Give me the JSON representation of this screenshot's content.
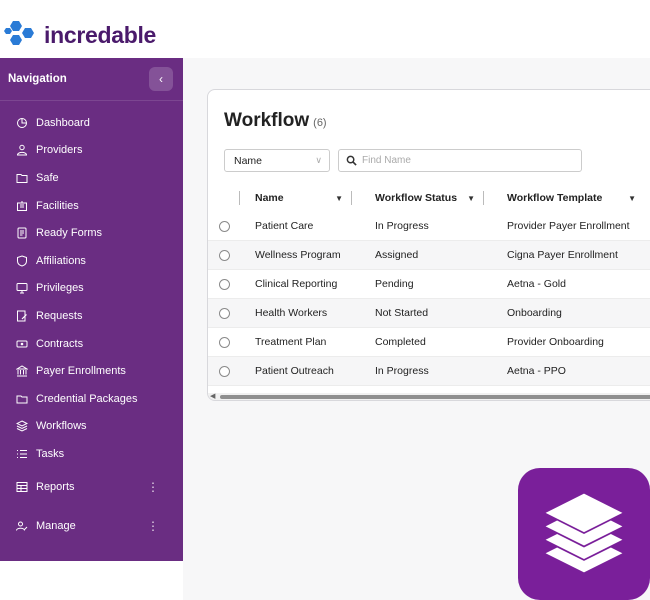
{
  "brand": {
    "name": "incredable",
    "logo_icon": "hexagon-cluster-logo",
    "color": "#4a1a6b"
  },
  "sidebar": {
    "title": "Navigation",
    "collapse_icon": "chevron-left-icon",
    "items": [
      {
        "label": "Dashboard",
        "icon": "dashboard-icon"
      },
      {
        "label": "Providers",
        "icon": "providers-icon"
      },
      {
        "label": "Safe",
        "icon": "safe-icon"
      },
      {
        "label": "Facilities",
        "icon": "facilities-icon"
      },
      {
        "label": "Ready Forms",
        "icon": "ready-forms-icon"
      },
      {
        "label": "Affiliations",
        "icon": "affiliations-icon"
      },
      {
        "label": "Privileges",
        "icon": "privileges-icon"
      },
      {
        "label": "Requests",
        "icon": "requests-icon"
      },
      {
        "label": "Contracts",
        "icon": "contracts-icon"
      },
      {
        "label": "Payer Enrollments",
        "icon": "payer-enrollments-icon"
      },
      {
        "label": "Credential Packages",
        "icon": "credential-packages-icon"
      },
      {
        "label": "Workflows",
        "icon": "workflows-icon"
      },
      {
        "label": "Tasks",
        "icon": "tasks-icon"
      }
    ],
    "groups": [
      {
        "label": "Reports",
        "icon": "reports-icon",
        "more": "⋮"
      },
      {
        "label": "Manage",
        "icon": "manage-icon",
        "more": "⋮"
      }
    ],
    "background": "#6a2d82"
  },
  "workflow": {
    "title": "Workflow",
    "count": "(6)",
    "filter_select": {
      "value": "Name"
    },
    "search": {
      "placeholder": "Find Name"
    },
    "columns": [
      "Name",
      "Workflow Status",
      "Workflow Template"
    ],
    "rows": [
      {
        "name": "Patient Care",
        "status": "In Progress",
        "template": "Provider Payer Enrollment"
      },
      {
        "name": "Wellness Program",
        "status": "Assigned",
        "template": "Cigna Payer Enrollment"
      },
      {
        "name": "Clinical Reporting",
        "status": "Pending",
        "template": "Aetna - Gold"
      },
      {
        "name": "Health Workers",
        "status": "Not Started",
        "template": "Onboarding"
      },
      {
        "name": "Treatment Plan",
        "status": "Completed",
        "template": "Provider Onboarding"
      },
      {
        "name": "Patient Outreach",
        "status": "In Progress",
        "template": "Aetna - PPO"
      }
    ]
  },
  "app_icon": {
    "icon": "stacked-layers-icon",
    "color": "#7a1f9a"
  }
}
